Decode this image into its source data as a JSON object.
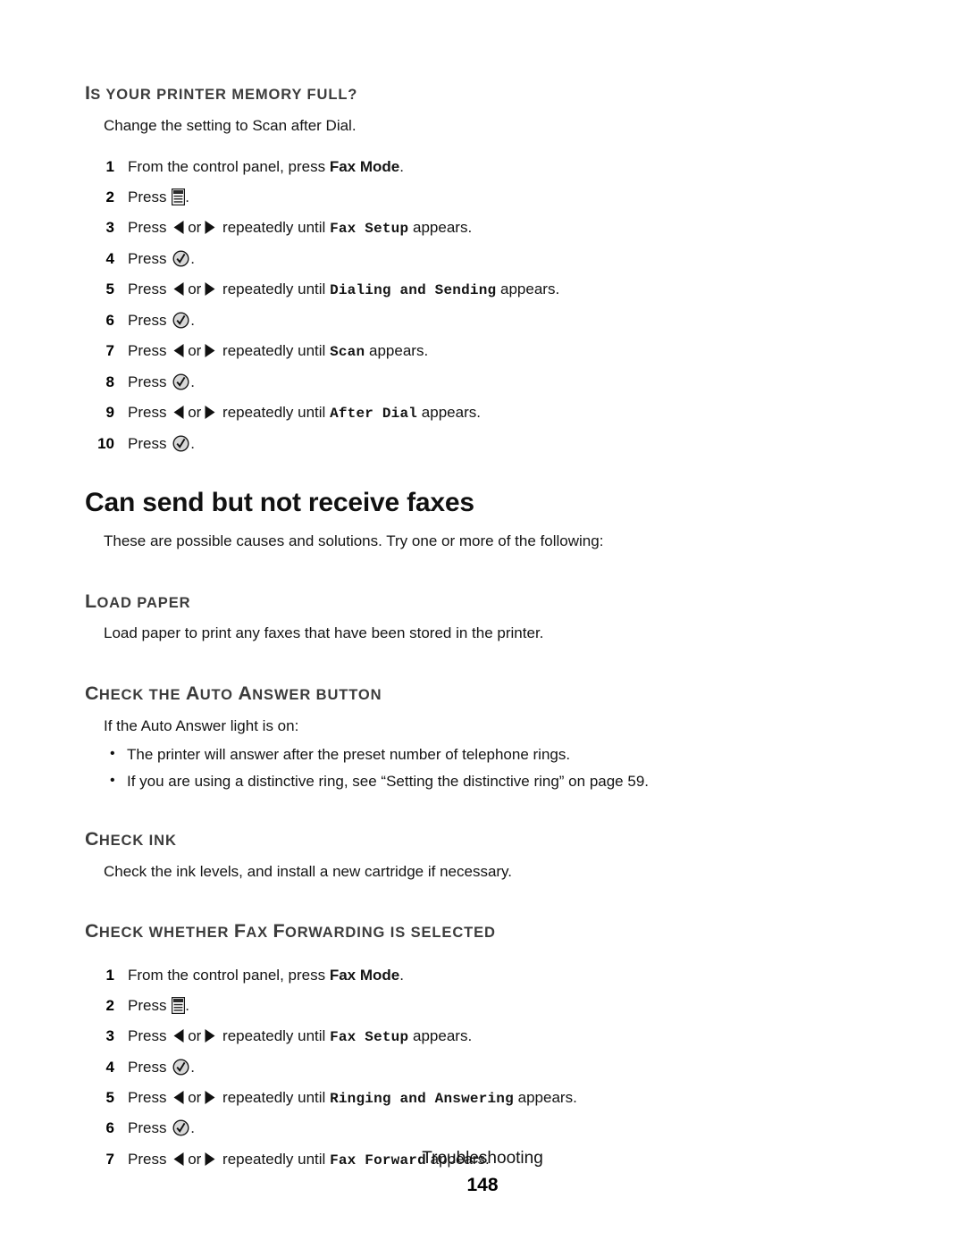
{
  "page": {
    "footer_chapter": "Troubleshooting",
    "footer_page_number": "148"
  },
  "icons": {
    "menu": "menu-icon",
    "left_arrow": "left-arrow-icon",
    "right_arrow": "right-arrow-icon",
    "select_check": "select-checkmark-icon"
  },
  "sections": [
    {
      "id": "printer-memory-full",
      "heading_cap": "I",
      "heading_rest": "S YOUR PRINTER MEMORY FULL?",
      "intro": "Change the setting to Scan after Dial.",
      "steps": [
        {
          "n": "1",
          "pre": "From the control panel, press ",
          "bold": "Fax Mode",
          "post": "."
        },
        {
          "n": "2",
          "pre": "Press ",
          "icon": "menu",
          "post": "."
        },
        {
          "n": "3",
          "pre": "Press ",
          "icon": "arrows",
          "mid": " repeatedly until ",
          "mono": "Fax Setup",
          "post": " appears."
        },
        {
          "n": "4",
          "pre": "Press ",
          "icon": "select",
          "post": "."
        },
        {
          "n": "5",
          "pre": "Press ",
          "icon": "arrows",
          "mid": " repeatedly until ",
          "mono": "Dialing and Sending",
          "post": " appears."
        },
        {
          "n": "6",
          "pre": "Press ",
          "icon": "select",
          "post": "."
        },
        {
          "n": "7",
          "pre": "Press ",
          "icon": "arrows",
          "mid": " repeatedly until ",
          "mono": "Scan",
          "post": " appears."
        },
        {
          "n": "8",
          "pre": "Press ",
          "icon": "select",
          "post": "."
        },
        {
          "n": "9",
          "pre": "Press ",
          "icon": "arrows",
          "mid": " repeatedly until ",
          "mono": "After Dial",
          "post": " appears."
        },
        {
          "n": "10",
          "pre": "Press ",
          "icon": "select",
          "post": "."
        }
      ]
    },
    {
      "id": "can-send-but-not-receive-faxes",
      "title": "Can send but not receive faxes",
      "intro": "These are possible causes and solutions. Try one or more of the following:"
    },
    {
      "id": "load-paper",
      "heading_cap": "L",
      "heading_rest": "OAD PAPER",
      "body": "Load paper to print any faxes that have been stored in the printer."
    },
    {
      "id": "check-auto-answer-button",
      "heading_parts": [
        {
          "cap": "C",
          "rest": "HECK THE "
        },
        {
          "cap": "A",
          "rest": "UTO "
        },
        {
          "cap": "A",
          "rest": "NSWER BUTTON"
        }
      ],
      "intro": "If the Auto Answer light is on:",
      "bullets": [
        "The printer will answer after the preset number of telephone rings.",
        "If you are using a distinctive ring, see “Setting the distinctive ring” on page 59."
      ]
    },
    {
      "id": "check-ink",
      "heading_cap": "C",
      "heading_rest": "HECK INK",
      "body": "Check the ink levels, and install a new cartridge if necessary."
    },
    {
      "id": "check-fax-forwarding",
      "heading_parts": [
        {
          "cap": "C",
          "rest": "HECK WHETHER "
        },
        {
          "cap": "F",
          "rest": "AX "
        },
        {
          "cap": "F",
          "rest": "ORWARDING IS SELECTED"
        }
      ],
      "steps": [
        {
          "n": "1",
          "pre": "From the control panel, press ",
          "bold": "Fax Mode",
          "post": "."
        },
        {
          "n": "2",
          "pre": "Press ",
          "icon": "menu",
          "post": "."
        },
        {
          "n": "3",
          "pre": "Press ",
          "icon": "arrows",
          "mid": " repeatedly until ",
          "mono": "Fax Setup",
          "post": " appears."
        },
        {
          "n": "4",
          "pre": "Press ",
          "icon": "select",
          "post": "."
        },
        {
          "n": "5",
          "pre": "Press ",
          "icon": "arrows",
          "mid": " repeatedly until ",
          "mono": "Ringing and Answering",
          "post": " appears."
        },
        {
          "n": "6",
          "pre": "Press ",
          "icon": "select",
          "post": "."
        },
        {
          "n": "7",
          "pre": "Press ",
          "icon": "arrows",
          "mid": " repeatedly until ",
          "mono": "Fax Forward",
          "post": " appears."
        }
      ]
    }
  ],
  "colors": {
    "heading_gray": "#3c3c3c",
    "body_black": "#141414",
    "icon_fill": "#d8d8d8",
    "icon_stroke": "#1a1a1a"
  }
}
